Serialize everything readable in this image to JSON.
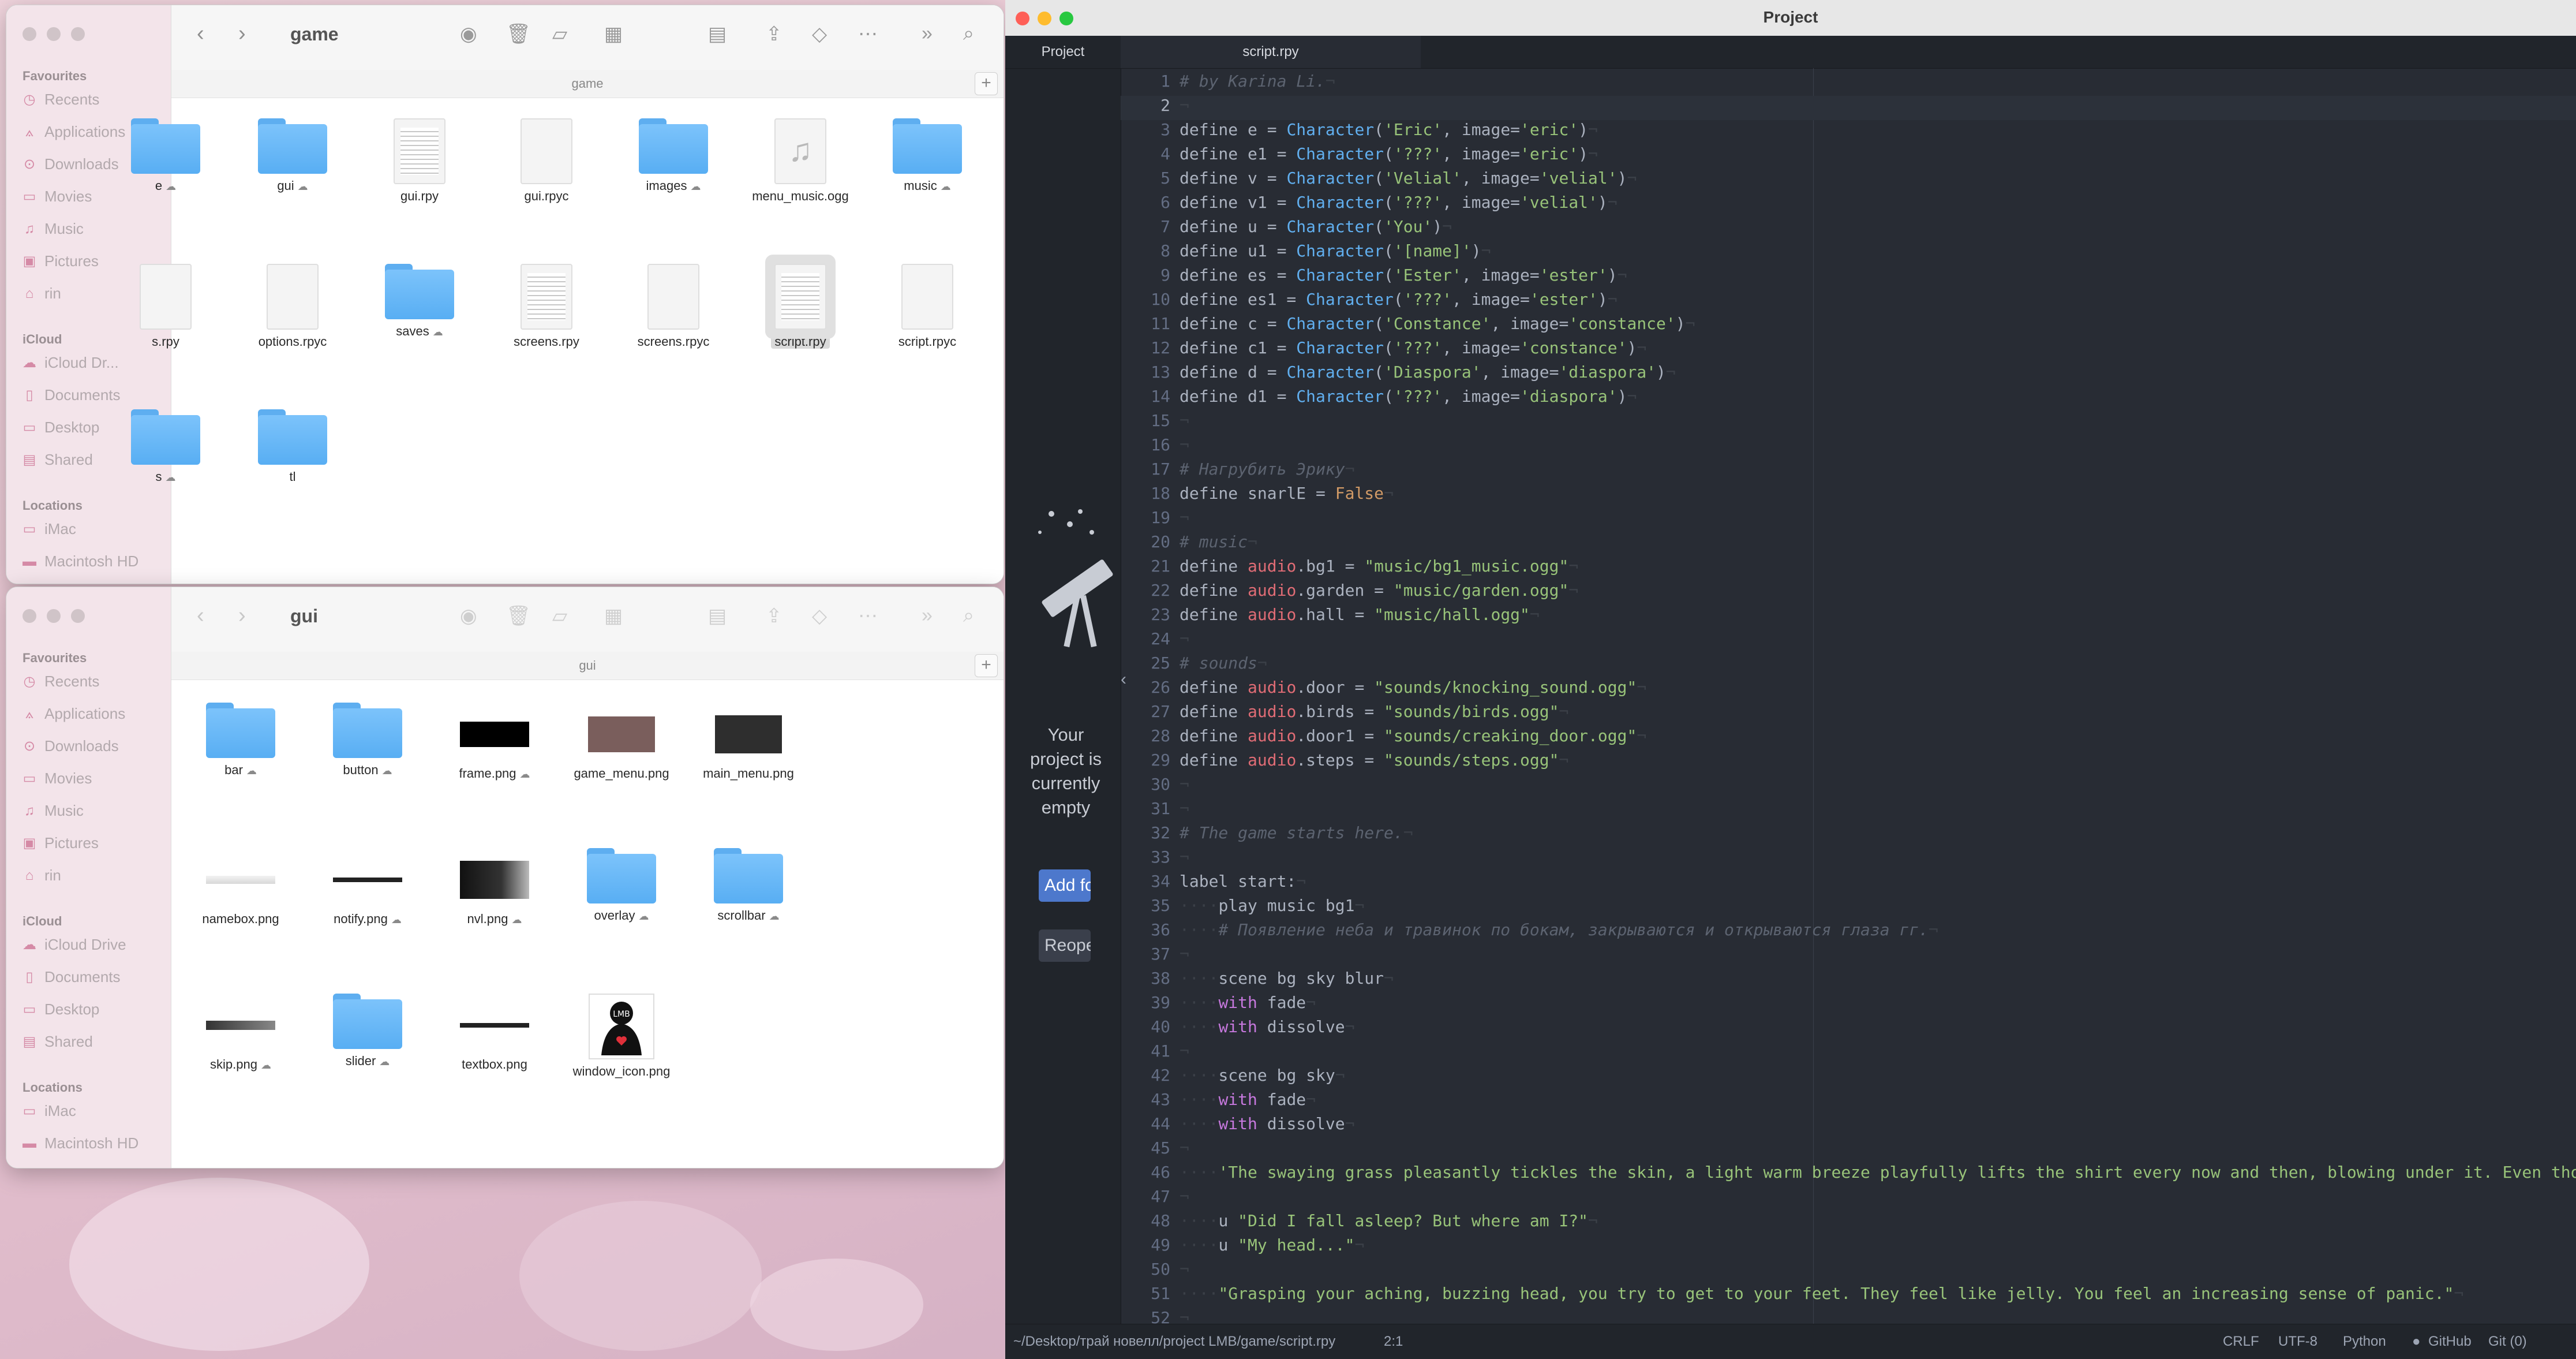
{
  "finder_game": {
    "title": "game",
    "path": "game",
    "sidebar": {
      "favourites_label": "Favourites",
      "favourites": [
        "Recents",
        "Applications",
        "Downloads",
        "Movies",
        "Music",
        "Pictures",
        "rin"
      ],
      "icloud_label": "iCloud",
      "icloud": [
        "iCloud Dr...",
        "Documents",
        "Desktop",
        "Shared"
      ],
      "locations_label": "Locations",
      "locations": [
        "iMac",
        "Macintosh HD"
      ]
    },
    "files": [
      {
        "name": "e",
        "kind": "folder",
        "cloud": true
      },
      {
        "name": "gui",
        "kind": "folder",
        "cloud": true
      },
      {
        "name": "gui.rpy",
        "kind": "doc",
        "cloud": false
      },
      {
        "name": "gui.rpyc",
        "kind": "blank",
        "cloud": false
      },
      {
        "name": "images",
        "kind": "folder",
        "cloud": true
      },
      {
        "name": "menu_music.ogg",
        "kind": "audio",
        "cloud": false
      },
      {
        "name": "music",
        "kind": "folder",
        "cloud": true
      },
      {
        "name": "s.rpy",
        "kind": "blank",
        "cloud": false
      },
      {
        "name": "options.rpyc",
        "kind": "blank",
        "cloud": false
      },
      {
        "name": "saves",
        "kind": "folder",
        "cloud": true
      },
      {
        "name": "screens.rpy",
        "kind": "doc",
        "cloud": false
      },
      {
        "name": "screens.rpyc",
        "kind": "blank",
        "cloud": false
      },
      {
        "name": "script.rpy",
        "kind": "doc",
        "cloud": false,
        "selected": true
      },
      {
        "name": "script.rpyc",
        "kind": "blank",
        "cloud": false
      },
      {
        "name": "s",
        "kind": "folder",
        "cloud": true
      },
      {
        "name": "tl",
        "kind": "folder",
        "cloud": false
      }
    ]
  },
  "finder_gui": {
    "title": "gui",
    "path": "gui",
    "sidebar": {
      "favourites_label": "Favourites",
      "favourites": [
        "Recents",
        "Applications",
        "Downloads",
        "Movies",
        "Music",
        "Pictures",
        "rin"
      ],
      "icloud_label": "iCloud",
      "icloud": [
        "iCloud Drive",
        "Documents",
        "Desktop",
        "Shared"
      ],
      "locations_label": "Locations",
      "locations": [
        "iMac",
        "Macintosh HD"
      ]
    },
    "files": [
      {
        "name": "bar",
        "kind": "folder",
        "cloud": true
      },
      {
        "name": "button",
        "kind": "folder",
        "cloud": true
      },
      {
        "name": "frame.png",
        "kind": "img-black",
        "cloud": true
      },
      {
        "name": "game_menu.png",
        "kind": "img-brown",
        "cloud": false
      },
      {
        "name": "main_menu.png",
        "kind": "img-dark",
        "cloud": false
      },
      {
        "name": "namebox.png",
        "kind": "img-thinlight",
        "cloud": false
      },
      {
        "name": "notify.png",
        "kind": "img-thin",
        "cloud": true
      },
      {
        "name": "nvl.png",
        "kind": "img-fade",
        "cloud": true
      },
      {
        "name": "overlay",
        "kind": "folder",
        "cloud": true
      },
      {
        "name": "scrollbar",
        "kind": "folder",
        "cloud": true
      },
      {
        "name": "skip.png",
        "kind": "img-skip",
        "cloud": true
      },
      {
        "name": "slider",
        "kind": "folder",
        "cloud": true
      },
      {
        "name": "textbox.png",
        "kind": "img-thin",
        "cloud": false
      },
      {
        "name": "window_icon.png",
        "kind": "img-icon",
        "cloud": false
      }
    ]
  },
  "editor": {
    "window_title": "Project",
    "tree_tab": "Project",
    "active_tab": "script.rpy",
    "empty_message": "Your project is currently empty",
    "add_folder_button": "Add folders",
    "reopen_button": "Reopen project",
    "current_line": 2,
    "lines": [
      [
        [
          "c",
          "# by Karina Li."
        ],
        [
          "ws",
          "¬"
        ]
      ],
      [
        [
          "ws",
          "¬"
        ]
      ],
      [
        [
          "p",
          "define e = "
        ],
        [
          "f",
          "Character"
        ],
        [
          "p",
          "("
        ],
        [
          "s",
          "'Eric'"
        ],
        [
          "p",
          ", image="
        ],
        [
          "s",
          "'eric'"
        ],
        [
          "p",
          ")"
        ],
        [
          "ws",
          "¬"
        ]
      ],
      [
        [
          "p",
          "define e1 = "
        ],
        [
          "f",
          "Character"
        ],
        [
          "p",
          "("
        ],
        [
          "s",
          "'???'"
        ],
        [
          "p",
          ", image="
        ],
        [
          "s",
          "'eric'"
        ],
        [
          "p",
          ")"
        ],
        [
          "ws",
          "¬"
        ]
      ],
      [
        [
          "p",
          "define v = "
        ],
        [
          "f",
          "Character"
        ],
        [
          "p",
          "("
        ],
        [
          "s",
          "'Velial'"
        ],
        [
          "p",
          ", image="
        ],
        [
          "s",
          "'velial'"
        ],
        [
          "p",
          ")"
        ],
        [
          "ws",
          "¬"
        ]
      ],
      [
        [
          "p",
          "define v1 = "
        ],
        [
          "f",
          "Character"
        ],
        [
          "p",
          "("
        ],
        [
          "s",
          "'???'"
        ],
        [
          "p",
          ", image="
        ],
        [
          "s",
          "'velial'"
        ],
        [
          "p",
          ")"
        ],
        [
          "ws",
          "¬"
        ]
      ],
      [
        [
          "p",
          "define u = "
        ],
        [
          "f",
          "Character"
        ],
        [
          "p",
          "("
        ],
        [
          "s",
          "'You'"
        ],
        [
          "p",
          ")"
        ],
        [
          "ws",
          "¬"
        ]
      ],
      [
        [
          "p",
          "define u1 = "
        ],
        [
          "f",
          "Character"
        ],
        [
          "p",
          "("
        ],
        [
          "s",
          "'[name]'"
        ],
        [
          "p",
          ")"
        ],
        [
          "ws",
          "¬"
        ]
      ],
      [
        [
          "p",
          "define es = "
        ],
        [
          "f",
          "Character"
        ],
        [
          "p",
          "("
        ],
        [
          "s",
          "'Ester'"
        ],
        [
          "p",
          ", image="
        ],
        [
          "s",
          "'ester'"
        ],
        [
          "p",
          ")"
        ],
        [
          "ws",
          "¬"
        ]
      ],
      [
        [
          "p",
          "define es1 = "
        ],
        [
          "f",
          "Character"
        ],
        [
          "p",
          "("
        ],
        [
          "s",
          "'???'"
        ],
        [
          "p",
          ", image="
        ],
        [
          "s",
          "'ester'"
        ],
        [
          "p",
          ")"
        ],
        [
          "ws",
          "¬"
        ]
      ],
      [
        [
          "p",
          "define c = "
        ],
        [
          "f",
          "Character"
        ],
        [
          "p",
          "("
        ],
        [
          "s",
          "'Constance'"
        ],
        [
          "p",
          ", image="
        ],
        [
          "s",
          "'constance'"
        ],
        [
          "p",
          ")"
        ],
        [
          "ws",
          "¬"
        ]
      ],
      [
        [
          "p",
          "define c1 = "
        ],
        [
          "f",
          "Character"
        ],
        [
          "p",
          "("
        ],
        [
          "s",
          "'???'"
        ],
        [
          "p",
          ", image="
        ],
        [
          "s",
          "'constance'"
        ],
        [
          "p",
          ")"
        ],
        [
          "ws",
          "¬"
        ]
      ],
      [
        [
          "p",
          "define d = "
        ],
        [
          "f",
          "Character"
        ],
        [
          "p",
          "("
        ],
        [
          "s",
          "'Diaspora'"
        ],
        [
          "p",
          ", image="
        ],
        [
          "s",
          "'diaspora'"
        ],
        [
          "p",
          ")"
        ],
        [
          "ws",
          "¬"
        ]
      ],
      [
        [
          "p",
          "define d1 = "
        ],
        [
          "f",
          "Character"
        ],
        [
          "p",
          "("
        ],
        [
          "s",
          "'???'"
        ],
        [
          "p",
          ", image="
        ],
        [
          "s",
          "'diaspora'"
        ],
        [
          "p",
          ")"
        ],
        [
          "ws",
          "¬"
        ]
      ],
      [
        [
          "ws",
          "¬"
        ]
      ],
      [
        [
          "ws",
          "¬"
        ]
      ],
      [
        [
          "c",
          "# Нагрубить Эрику"
        ],
        [
          "ws",
          "¬"
        ]
      ],
      [
        [
          "p",
          "define snarlE = "
        ],
        [
          "n",
          "False"
        ],
        [
          "ws",
          "¬"
        ]
      ],
      [
        [
          "ws",
          "¬"
        ]
      ],
      [
        [
          "c",
          "# music"
        ],
        [
          "ws",
          "¬"
        ]
      ],
      [
        [
          "p",
          "define "
        ],
        [
          "v",
          "audio"
        ],
        [
          "p",
          ".bg1 = "
        ],
        [
          "s",
          "\"music/bg1_music.ogg\""
        ],
        [
          "ws",
          "¬"
        ]
      ],
      [
        [
          "p",
          "define "
        ],
        [
          "v",
          "audio"
        ],
        [
          "p",
          ".garden = "
        ],
        [
          "s",
          "\"music/garden.ogg\""
        ],
        [
          "ws",
          "¬"
        ]
      ],
      [
        [
          "p",
          "define "
        ],
        [
          "v",
          "audio"
        ],
        [
          "p",
          ".hall = "
        ],
        [
          "s",
          "\"music/hall.ogg\""
        ],
        [
          "ws",
          "¬"
        ]
      ],
      [
        [
          "ws",
          "¬"
        ]
      ],
      [
        [
          "c",
          "# sounds"
        ],
        [
          "ws",
          "¬"
        ]
      ],
      [
        [
          "p",
          "define "
        ],
        [
          "v",
          "audio"
        ],
        [
          "p",
          ".door = "
        ],
        [
          "s",
          "\"sounds/knocking_sound.ogg\""
        ],
        [
          "ws",
          "¬"
        ]
      ],
      [
        [
          "p",
          "define "
        ],
        [
          "v",
          "audio"
        ],
        [
          "p",
          ".birds = "
        ],
        [
          "s",
          "\"sounds/birds.ogg\""
        ],
        [
          "ws",
          "¬"
        ]
      ],
      [
        [
          "p",
          "define "
        ],
        [
          "v",
          "audio"
        ],
        [
          "p",
          ".door1 = "
        ],
        [
          "s",
          "\"sounds/creaking_door.ogg\""
        ],
        [
          "ws",
          "¬"
        ]
      ],
      [
        [
          "p",
          "define "
        ],
        [
          "v",
          "audio"
        ],
        [
          "p",
          ".steps = "
        ],
        [
          "s",
          "\"sounds/steps.ogg\""
        ],
        [
          "ws",
          "¬"
        ]
      ],
      [
        [
          "ws",
          "¬"
        ]
      ],
      [
        [
          "ws",
          "¬"
        ]
      ],
      [
        [
          "c",
          "# The game starts here."
        ],
        [
          "ws",
          "¬"
        ]
      ],
      [
        [
          "ws",
          "¬"
        ]
      ],
      [
        [
          "p",
          "label start:"
        ],
        [
          "ws",
          "¬"
        ]
      ],
      [
        [
          "ws",
          "····"
        ],
        [
          "p",
          "play music bg1"
        ],
        [
          "ws",
          "¬"
        ]
      ],
      [
        [
          "ws",
          "····"
        ],
        [
          "c",
          "# Появление неба и травинок по бокам, закрываются и открываются глаза гг."
        ],
        [
          "ws",
          "¬"
        ]
      ],
      [
        [
          "ws",
          "¬"
        ]
      ],
      [
        [
          "ws",
          "····"
        ],
        [
          "p",
          "scene bg sky blur"
        ],
        [
          "ws",
          "¬"
        ]
      ],
      [
        [
          "ws",
          "····"
        ],
        [
          "k",
          "with"
        ],
        [
          "p",
          " fade"
        ],
        [
          "ws",
          "¬"
        ]
      ],
      [
        [
          "ws",
          "····"
        ],
        [
          "k",
          "with"
        ],
        [
          "p",
          " dissolve"
        ],
        [
          "ws",
          "¬"
        ]
      ],
      [
        [
          "ws",
          "¬"
        ]
      ],
      [
        [
          "ws",
          "····"
        ],
        [
          "p",
          "scene bg sky"
        ],
        [
          "ws",
          "¬"
        ]
      ],
      [
        [
          "ws",
          "····"
        ],
        [
          "k",
          "with"
        ],
        [
          "p",
          " fade"
        ],
        [
          "ws",
          "¬"
        ]
      ],
      [
        [
          "ws",
          "····"
        ],
        [
          "k",
          "with"
        ],
        [
          "p",
          " dissolve"
        ],
        [
          "ws",
          "¬"
        ]
      ],
      [
        [
          "ws",
          "¬"
        ]
      ],
      [
        [
          "ws",
          "····"
        ],
        [
          "s",
          "'The swaying grass pleasantly tickles the skin, a light warm breeze playfully lifts the shirt every now and then, blowing under it. Even though"
        ]
      ],
      [
        [
          "ws",
          "¬"
        ]
      ],
      [
        [
          "ws",
          "····"
        ],
        [
          "p",
          "u "
        ],
        [
          "s",
          "\"Did I fall asleep? But where am I?\""
        ],
        [
          "ws",
          "¬"
        ]
      ],
      [
        [
          "ws",
          "····"
        ],
        [
          "p",
          "u "
        ],
        [
          "s",
          "\"My head...\""
        ],
        [
          "ws",
          "¬"
        ]
      ],
      [
        [
          "ws",
          "¬"
        ]
      ],
      [
        [
          "ws",
          "····"
        ],
        [
          "s",
          "\"Grasping your aching, buzzing head, you try to get to your feet. They feel like jelly. You feel an increasing sense of panic.\""
        ],
        [
          "ws",
          "¬"
        ]
      ],
      [
        [
          "ws",
          "¬"
        ]
      ]
    ],
    "status": {
      "path": "~/Desktop/трай новелл/project LMB/game/script.rpy",
      "cursor": "2:1",
      "line_ending": "CRLF",
      "encoding": "UTF-8",
      "grammar": "Python",
      "github": "GitHub",
      "git": "Git (0)"
    }
  },
  "colors": {
    "editor_bg": "#282c34",
    "keyword": "#c678dd",
    "function": "#61afef",
    "string": "#98c379",
    "comment": "#5c6370",
    "number": "#d19a66",
    "variable": "#e06c75",
    "folder": "#6bbaf7",
    "accent_button": "#4d78cc"
  },
  "icons": [
    "back-icon",
    "forward-icon",
    "airdrop-icon",
    "trash-icon",
    "new-folder-icon",
    "view-grid-icon",
    "group-icon",
    "share-icon",
    "tag-icon",
    "more-icon",
    "search-icon",
    "cloud-icon",
    "telescope-icon"
  ]
}
